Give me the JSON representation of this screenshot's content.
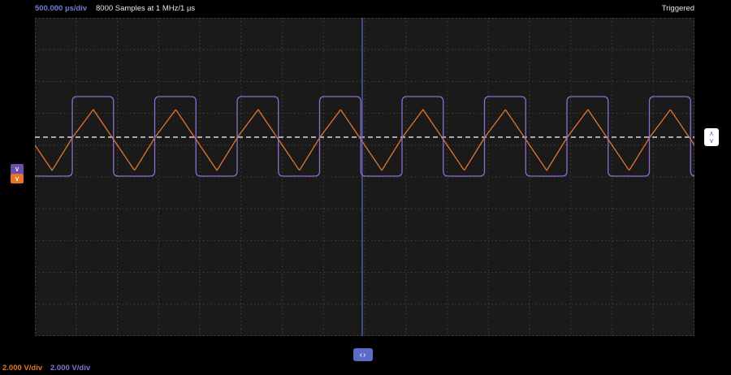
{
  "header": {
    "timebase": "500.000 µs/div",
    "samples": "8000 Samples at 1 MHz/1 µs",
    "status": "Triggered"
  },
  "channels": {
    "ch1": {
      "scale": "2.000 V/div",
      "color": "#e8742a",
      "waveform": "triangle"
    },
    "ch2": {
      "scale": "2.000 V/div",
      "color": "#8a6fd0",
      "waveform": "square"
    }
  },
  "colors": {
    "background": "#000000",
    "plot_background": "#1a1a1a",
    "grid": "#4a4a4a",
    "cursor": "#5a6cc8",
    "trigger_level": "#ffffff"
  },
  "icons": {
    "ch2_marker": "chevron-down-icon",
    "ch1_marker": "chevron-down-icon",
    "trigger_level_control": "up-down-chevron-icon",
    "horizontal_pan_control": "left-right-chevron-icon"
  }
}
